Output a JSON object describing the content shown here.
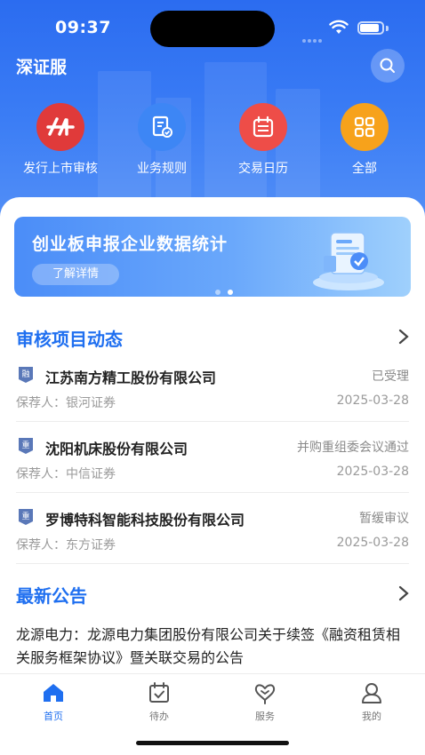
{
  "status_bar": {
    "time": "09:37"
  },
  "header": {
    "title": "深证服"
  },
  "shortcuts": [
    {
      "label": "发行上市审核",
      "icon": "ipo-review-icon",
      "color": "#e03a3a"
    },
    {
      "label": "业务规则",
      "icon": "rules-document-icon",
      "color": "#3d86f5"
    },
    {
      "label": "交易日历",
      "icon": "calendar-icon",
      "color": "#ee4d48"
    },
    {
      "label": "全部",
      "icon": "grid-all-icon",
      "color": "#f7a21b"
    }
  ],
  "banner": {
    "title": "创业板申报企业数据统计",
    "button": "了解详情",
    "slides": 2,
    "active_slide": 2
  },
  "review_section": {
    "title": "审核项目动态",
    "items": [
      {
        "badge": "融",
        "name": "江苏南方精工股份有限公司",
        "status": "已受理",
        "recommender": "保荐人：银河证券",
        "date": "2025-03-28"
      },
      {
        "badge": "重",
        "name": "沈阳机床股份有限公司",
        "status": "并购重组委会议通过",
        "recommender": "保荐人：中信证券",
        "date": "2025-03-28"
      },
      {
        "badge": "重",
        "name": "罗博特科智能科技股份有限公司",
        "status": "暂缓审议",
        "recommender": "保荐人：东方证券",
        "date": "2025-03-28"
      }
    ]
  },
  "notice_section": {
    "title": "最新公告",
    "text": "龙源电力：龙源电力集团股份有限公司关于续签《融资租赁相关服务框架协议》暨关联交易的公告"
  },
  "tabs": [
    {
      "label": "首页",
      "icon": "home-icon",
      "active": true
    },
    {
      "label": "待办",
      "icon": "todo-calendar-icon",
      "active": false
    },
    {
      "label": "服务",
      "icon": "service-heart-icon",
      "active": false
    },
    {
      "label": "我的",
      "icon": "profile-icon",
      "active": false
    }
  ],
  "colors": {
    "brand": "#1f6ff0",
    "hero": "#3b7df5"
  }
}
